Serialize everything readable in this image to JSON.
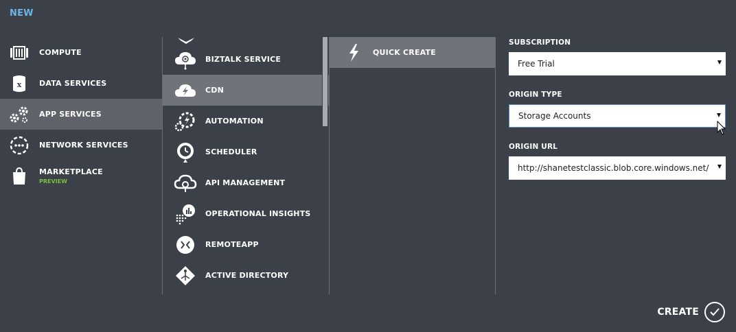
{
  "header": {
    "title": "NEW"
  },
  "categories": [
    {
      "label": "COMPUTE",
      "icon": "compute-icon",
      "selected": false
    },
    {
      "label": "DATA SERVICES",
      "icon": "data-services-icon",
      "selected": false
    },
    {
      "label": "APP SERVICES",
      "icon": "app-services-icon",
      "selected": true
    },
    {
      "label": "NETWORK SERVICES",
      "icon": "network-services-icon",
      "selected": false
    },
    {
      "label": "MARKETPLACE",
      "sublabel": "PREVIEW",
      "icon": "marketplace-icon",
      "selected": false
    }
  ],
  "services": [
    {
      "label": "BIZTALK SERVICE",
      "icon": "biztalk-icon",
      "selected": false
    },
    {
      "label": "CDN",
      "icon": "cdn-icon",
      "selected": true
    },
    {
      "label": "AUTOMATION",
      "icon": "automation-icon",
      "selected": false
    },
    {
      "label": "SCHEDULER",
      "icon": "scheduler-icon",
      "selected": false
    },
    {
      "label": "API MANAGEMENT",
      "icon": "api-management-icon",
      "selected": false
    },
    {
      "label": "OPERATIONAL INSIGHTS",
      "icon": "operational-insights-icon",
      "selected": false
    },
    {
      "label": "REMOTEAPP",
      "icon": "remoteapp-icon",
      "selected": false
    },
    {
      "label": "ACTIVE DIRECTORY",
      "icon": "active-directory-icon",
      "selected": false
    }
  ],
  "actions": [
    {
      "label": "QUICK CREATE",
      "icon": "lightning-icon",
      "selected": true
    }
  ],
  "form": {
    "subscription": {
      "label": "SUBSCRIPTION",
      "value": "Free Trial"
    },
    "origin_type": {
      "label": "ORIGIN TYPE",
      "value": "Storage Accounts"
    },
    "origin_url": {
      "label": "ORIGIN URL",
      "value": "http://shanetestclassic.blob.core.windows.net/"
    }
  },
  "footer": {
    "create_label": "CREATE"
  },
  "colors": {
    "background": "#3c4048",
    "selected": "#70737a",
    "accent": "#6cb4e6",
    "preview": "#7bbf3a"
  }
}
